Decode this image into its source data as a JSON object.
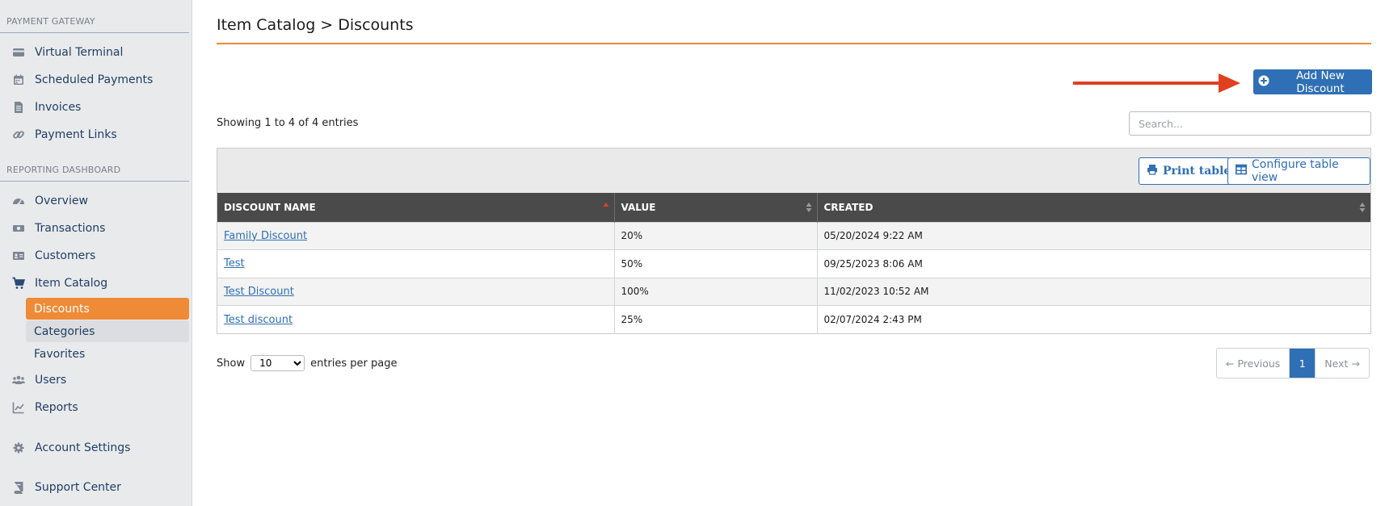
{
  "sidebar": {
    "sections": [
      {
        "title": "PAYMENT GATEWAY",
        "items": [
          {
            "label": "Virtual Terminal",
            "icon": "credit-card-icon"
          },
          {
            "label": "Scheduled Payments",
            "icon": "calendar-icon"
          },
          {
            "label": "Invoices",
            "icon": "document-icon"
          },
          {
            "label": "Payment Links",
            "icon": "link-icon"
          }
        ]
      },
      {
        "title": "REPORTING DASHBOARD",
        "items": [
          {
            "label": "Overview",
            "icon": "gauge-icon"
          },
          {
            "label": "Transactions",
            "icon": "money-icon"
          },
          {
            "label": "Customers",
            "icon": "id-card-icon"
          },
          {
            "label": "Item Catalog",
            "icon": "cart-icon"
          }
        ]
      }
    ],
    "catalog_subitems": [
      {
        "label": "Discounts",
        "state": "active"
      },
      {
        "label": "Categories",
        "state": "hover"
      },
      {
        "label": "Favorites",
        "state": "normal"
      }
    ],
    "after_items": [
      {
        "label": "Users",
        "icon": "users-icon"
      },
      {
        "label": "Reports",
        "icon": "chart-icon"
      },
      {
        "label": "Account Settings",
        "icon": "gear-icon"
      },
      {
        "label": "Support Center",
        "icon": "book-icon"
      }
    ]
  },
  "page": {
    "title": "Item Catalog > Discounts",
    "add_button": "Add New Discount",
    "showing": "Showing 1 to 4 of 4 entries",
    "search_placeholder": "Search...",
    "print_button": "Print table",
    "configure_button": "Configure table view"
  },
  "table": {
    "columns": [
      "DISCOUNT NAME",
      "VALUE",
      "CREATED"
    ],
    "rows": [
      {
        "name": "Family Discount",
        "value": "20%",
        "created": "05/20/2024 9:22 AM"
      },
      {
        "name": "Test",
        "value": "50%",
        "created": "09/25/2023 8:06 AM"
      },
      {
        "name": "Test Discount",
        "value": "100%",
        "created": "11/02/2023 10:52 AM"
      },
      {
        "name": "Test discount",
        "value": "25%",
        "created": "02/07/2024 2:43 PM"
      }
    ]
  },
  "pagination": {
    "show_label": "Show",
    "per_page_value": "10",
    "per_page_options": [
      "10"
    ],
    "per_page_suffix": "entries per page",
    "previous": "← Previous",
    "current": "1",
    "next": "Next →"
  },
  "colors": {
    "accent_orange": "#ef8b36",
    "primary_blue": "#2f6fb5",
    "arrow_red": "#e0401f",
    "header_dark": "#4a4a4a"
  }
}
